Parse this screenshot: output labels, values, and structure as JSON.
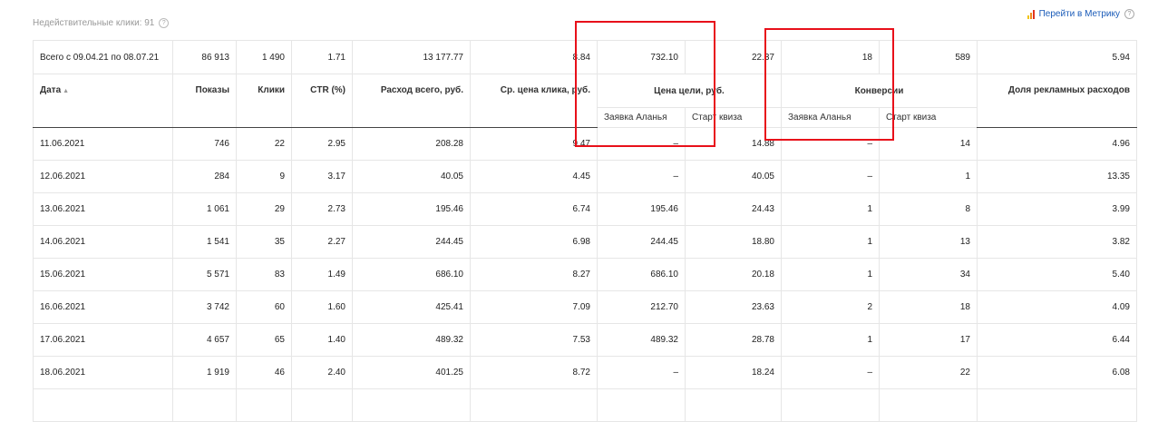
{
  "header": {
    "invalid_clicks": "Недействительные клики: 91",
    "help_glyph": "?",
    "metrika_link": "Перейти в Метрику",
    "metrika_icon_colors": [
      "#f2c40f",
      "#f08c1e",
      "#e1341e"
    ]
  },
  "table": {
    "columns": {
      "date": "Дата",
      "sort_arrow": "▲",
      "shows": "Показы",
      "clicks": "Клики",
      "ctr": "CTR (%)",
      "spend": "Расход всего, руб.",
      "cpc": "Ср. цена клика, руб.",
      "goal_price_group": "Цена цели, руб.",
      "conversions_group": "Конверсии",
      "ad_share": "Доля рекламных расходов"
    },
    "subcolumns": {
      "goal_price_a": "Заявка Аланья",
      "goal_price_b": "Старт квиза",
      "conv_a": "Заявка Аланья",
      "conv_b": "Старт квиза"
    },
    "total": [
      "Всего с 09.04.21 по 08.07.21",
      "86 913",
      "1 490",
      "1.71",
      "13 177.77",
      "8.84",
      "732.10",
      "22.37",
      "18",
      "589",
      "5.94"
    ],
    "rows": [
      [
        "11.06.2021",
        "746",
        "22",
        "2.95",
        "208.28",
        "9.47",
        "–",
        "14.88",
        "–",
        "14",
        "4.96"
      ],
      [
        "12.06.2021",
        "284",
        "9",
        "3.17",
        "40.05",
        "4.45",
        "–",
        "40.05",
        "–",
        "1",
        "13.35"
      ],
      [
        "13.06.2021",
        "1 061",
        "29",
        "2.73",
        "195.46",
        "6.74",
        "195.46",
        "24.43",
        "1",
        "8",
        "3.99"
      ],
      [
        "14.06.2021",
        "1 541",
        "35",
        "2.27",
        "244.45",
        "6.98",
        "244.45",
        "18.80",
        "1",
        "13",
        "3.82"
      ],
      [
        "15.06.2021",
        "5 571",
        "83",
        "1.49",
        "686.10",
        "8.27",
        "686.10",
        "20.18",
        "1",
        "34",
        "5.40"
      ],
      [
        "16.06.2021",
        "3 742",
        "60",
        "1.60",
        "425.41",
        "7.09",
        "212.70",
        "23.63",
        "2",
        "18",
        "4.09"
      ],
      [
        "17.06.2021",
        "4 657",
        "65",
        "1.40",
        "489.32",
        "7.53",
        "489.32",
        "28.78",
        "1",
        "17",
        "6.44"
      ],
      [
        "18.06.2021",
        "1 919",
        "46",
        "2.40",
        "401.25",
        "8.72",
        "–",
        "18.24",
        "–",
        "22",
        "6.08"
      ],
      [
        "",
        "",
        "",
        "",
        "",
        "",
        "",
        "",
        "",
        "",
        ""
      ]
    ]
  },
  "highlight_color": "#e8101a"
}
